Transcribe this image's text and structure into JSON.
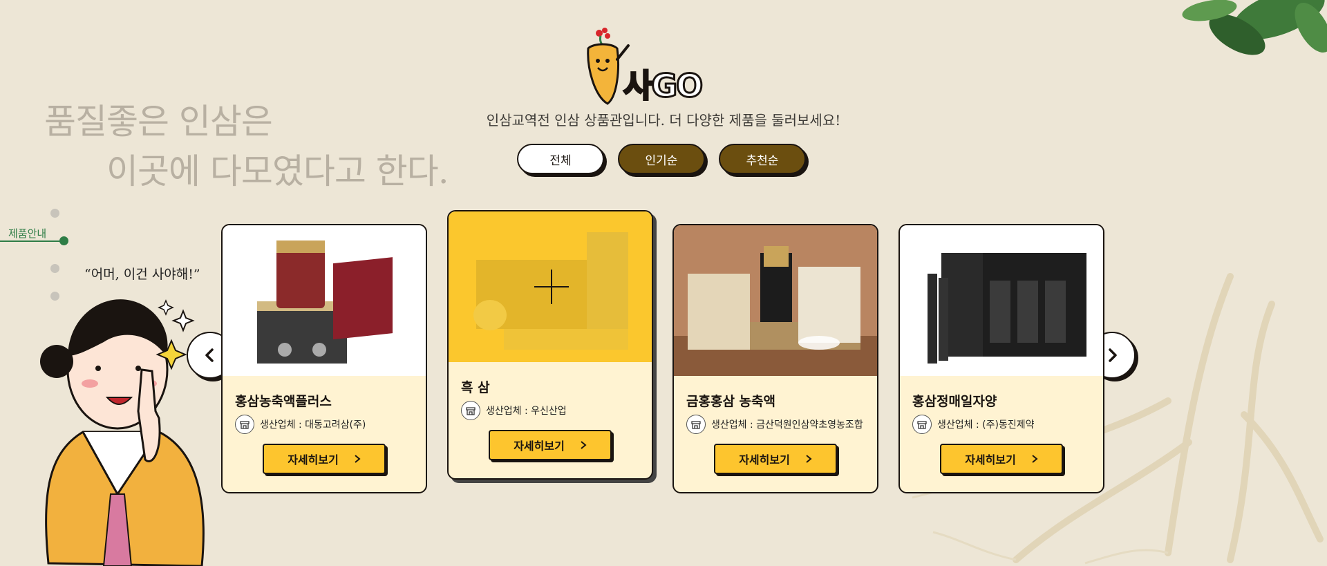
{
  "headline": {
    "line1": "품질좋은 인삼은",
    "line2": "이곳에 다모였다고 한다."
  },
  "logo": {
    "text": "사GO"
  },
  "subtitle": "인삼교역전 인삼 상품관입니다. 더 다양한 제품을 둘러보세요!",
  "filters": [
    {
      "label": "전체",
      "active": true
    },
    {
      "label": "인기순",
      "active": false
    },
    {
      "label": "추천순",
      "active": false
    }
  ],
  "side_nav": {
    "active_label": "제품안내"
  },
  "quote": "“어머, 이건 사야해!”",
  "products": [
    {
      "title": "홍삼농축액플러스",
      "maker_label": "생산업체 : 대동고려삼(주)",
      "button": "자세히보기",
      "featured": false
    },
    {
      "title": "흑 삼",
      "maker_label": "생산업체 : 우신산업",
      "button": "자세히보기",
      "featured": true
    },
    {
      "title": "금홍홍삼 농축액",
      "maker_label": "생산업체 : 금산덕원인삼약초영농조합",
      "button": "자세히보기",
      "featured": false
    },
    {
      "title": "홍삼정매일자양",
      "maker_label": "생산업체 : (주)동진제약",
      "button": "자세히보기",
      "featured": false
    }
  ],
  "colors": {
    "accent_yellow": "#fdc52e",
    "dark_brown": "#6b4e0f",
    "nav_green": "#2e7d46",
    "background": "#ede6d6"
  },
  "icons": [
    "chevron-left-icon",
    "chevron-right-icon",
    "store-icon",
    "plus-icon"
  ]
}
